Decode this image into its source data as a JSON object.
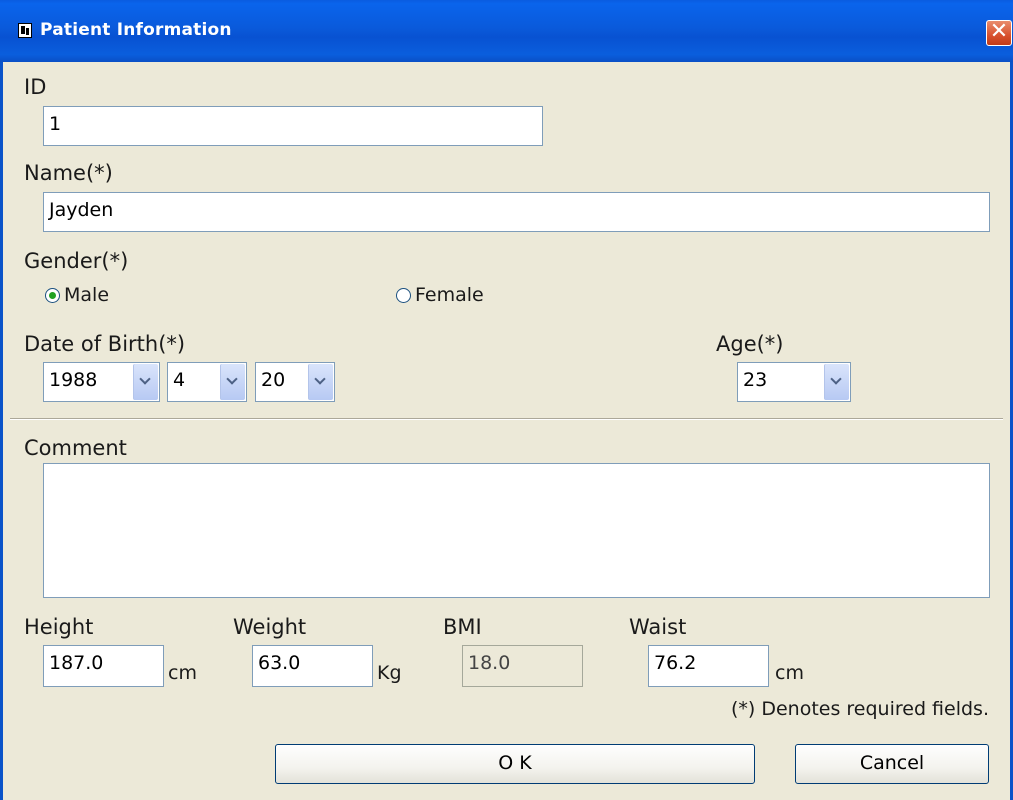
{
  "window": {
    "title": "Patient Information",
    "close_glyph": "✕"
  },
  "fields": {
    "id": {
      "label": "ID",
      "value": "1"
    },
    "name": {
      "label": "Name(*)",
      "value": "Jayden"
    },
    "gender": {
      "label": "Gender(*)",
      "options": [
        {
          "label": "Male",
          "checked": true
        },
        {
          "label": "Female",
          "checked": false
        }
      ]
    },
    "dob": {
      "label": "Date of Birth(*)",
      "year": "1988",
      "month": "4",
      "day": "20"
    },
    "age": {
      "label": "Age(*)",
      "value": "23"
    },
    "comment": {
      "label": "Comment",
      "value": ""
    },
    "height": {
      "label": "Height",
      "value": "187.0",
      "unit": "cm"
    },
    "weight": {
      "label": "Weight",
      "value": "63.0",
      "unit": "Kg"
    },
    "bmi": {
      "label": "BMI",
      "value": "18.0"
    },
    "waist": {
      "label": "Waist",
      "value": "76.2",
      "unit": "cm"
    }
  },
  "note": "(*) Denotes required fields.",
  "buttons": {
    "ok": "O K",
    "cancel": "Cancel"
  },
  "icons": {
    "app": "patient-app-icon",
    "close": "close-icon",
    "dropdown": "chevron-down-icon"
  },
  "colors": {
    "titlebar": "#0a5ce0",
    "background": "#ece9d8",
    "close": "#d8512e",
    "radio_dot": "#21a121"
  }
}
